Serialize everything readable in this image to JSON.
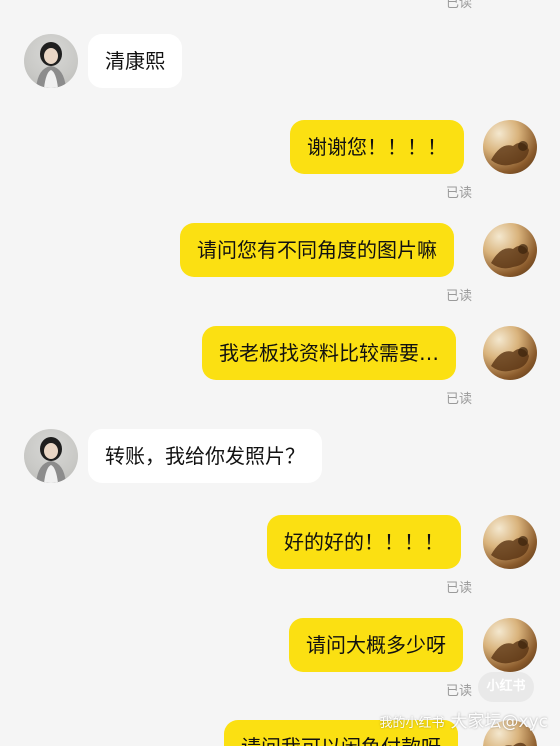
{
  "chat": {
    "read_label": "已读",
    "messages": [
      {
        "side": "in",
        "text": "清康熙"
      },
      {
        "side": "out",
        "text": "谢谢您！！！！",
        "status": "已读"
      },
      {
        "side": "out",
        "text": "请问您有不同角度的图片嘛",
        "status": "已读"
      },
      {
        "side": "out",
        "text": "我老板找资料比较需要…",
        "status": "已读"
      },
      {
        "side": "in",
        "text": "转账，我给你发照片？"
      },
      {
        "side": "out",
        "text": "好的好的！！！！",
        "status": "已读"
      },
      {
        "side": "out",
        "text": "请问大概多少呀",
        "status": "已读"
      },
      {
        "side": "out",
        "text": "请问我可以闲鱼付款呀"
      }
    ]
  },
  "watermark": {
    "prefix": "我的小红书",
    "text": "大家坛@xyc",
    "badge": "小红书"
  }
}
